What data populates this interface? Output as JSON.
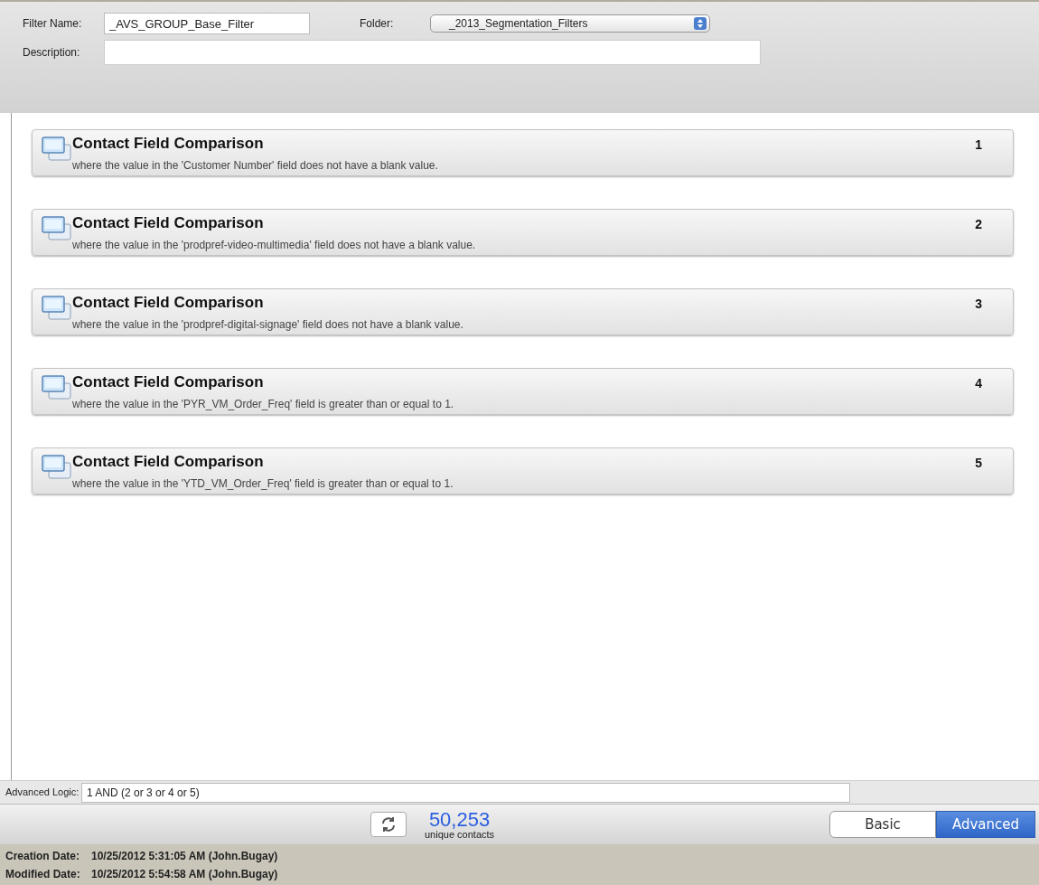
{
  "filter_name": {
    "label": "Filter Name:",
    "value": "_AVS_GROUP_Base_Filter"
  },
  "folder": {
    "label": "Folder:",
    "value": "_2013_Segmentation_Filters"
  },
  "description": {
    "label": "Description:"
  },
  "criteria": [
    {
      "title": "Contact Field Comparison",
      "detail": "where the value in the 'Customer Number' field does not have a blank value.",
      "number": "1"
    },
    {
      "title": "Contact Field Comparison",
      "detail": "where the value in the 'prodpref-video-multimedia' field does not have a blank value.",
      "number": "2"
    },
    {
      "title": "Contact Field Comparison",
      "detail": "where the value in the 'prodpref-digital-signage' field does not have a blank value.",
      "number": "3"
    },
    {
      "title": "Contact Field Comparison",
      "detail": "where the value in the 'PYR_VM_Order_Freq' field is greater than or equal to 1.",
      "number": "4"
    },
    {
      "title": "Contact Field Comparison",
      "detail": "where the value in the 'YTD_VM_Order_Freq' field is greater than or equal to 1.",
      "number": "5"
    }
  ],
  "advanced_logic": {
    "label": "Advanced Logic:",
    "value": "1 AND (2 or 3 or 4 or 5)"
  },
  "count": {
    "value": "50,253",
    "caption": "unique contacts"
  },
  "mode_tabs": [
    {
      "label": "Basic",
      "selected": false
    },
    {
      "label": "Advanced",
      "selected": true
    }
  ],
  "footer": [
    {
      "label": "Creation Date:",
      "value": "10/25/2012 5:31:05 AM (John.Bugay)"
    },
    {
      "label": "Modified Date:",
      "value": "10/25/2012 5:54:58 AM (John.Bugay)"
    }
  ]
}
